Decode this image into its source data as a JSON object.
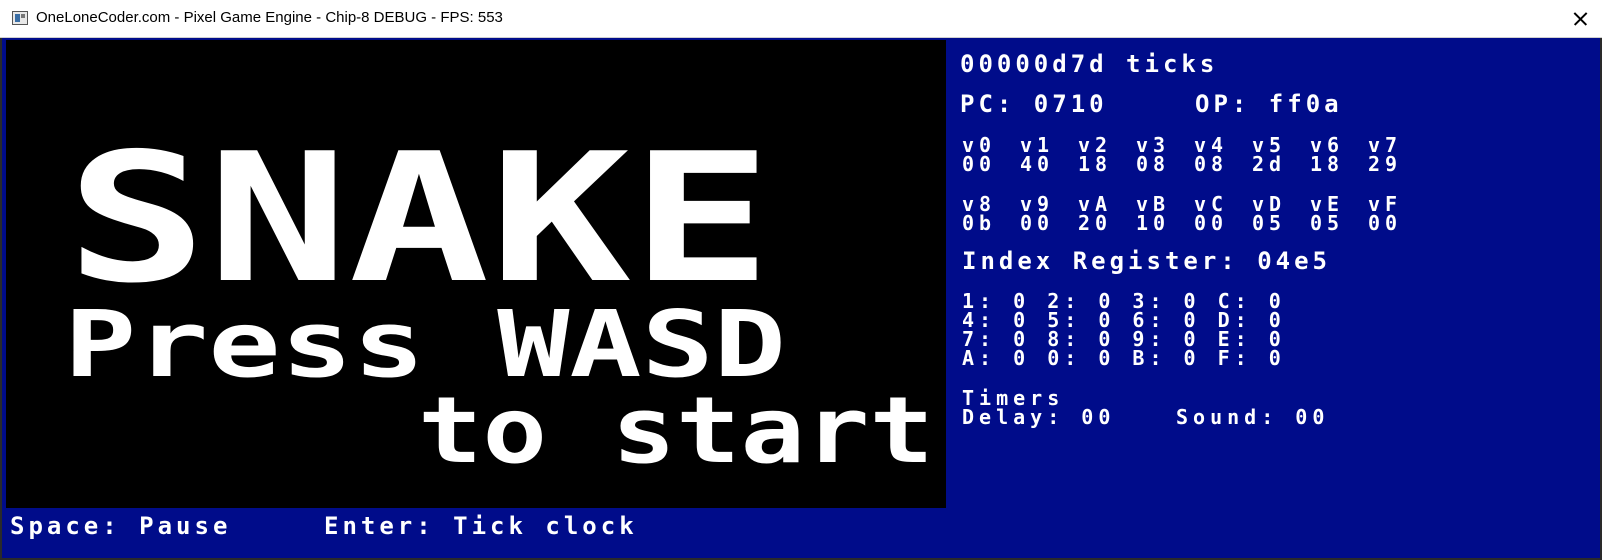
{
  "window": {
    "title": "OneLoneCoder.com - Pixel Game Engine - Chip-8 DEBUG - FPS: 553",
    "app_icon": "app-window-icon",
    "close_icon": "close-icon"
  },
  "screen": {
    "title_text": "SNAKE",
    "line1": "Press WASD",
    "line2": "to start"
  },
  "debug": {
    "ticks": "00000d7d ticks",
    "pc": "PC: 0710",
    "op": "OP: ff0a",
    "registers_row1": [
      {
        "name": "v0",
        "value": "00"
      },
      {
        "name": "v1",
        "value": "40"
      },
      {
        "name": "v2",
        "value": "18"
      },
      {
        "name": "v3",
        "value": "08"
      },
      {
        "name": "v4",
        "value": "08"
      },
      {
        "name": "v5",
        "value": "2d"
      },
      {
        "name": "v6",
        "value": "18"
      },
      {
        "name": "v7",
        "value": "29"
      }
    ],
    "registers_row2": [
      {
        "name": "v8",
        "value": "0b"
      },
      {
        "name": "v9",
        "value": "00"
      },
      {
        "name": "vA",
        "value": "20"
      },
      {
        "name": "vB",
        "value": "10"
      },
      {
        "name": "vC",
        "value": "00"
      },
      {
        "name": "vD",
        "value": "05"
      },
      {
        "name": "vE",
        "value": "05"
      },
      {
        "name": "vF",
        "value": "00"
      }
    ],
    "index_register": "Index Register: 04e5",
    "keys": [
      "1: 0 2: 0 3: 0 C: 0",
      "4: 0 5: 0 6: 0 D: 0",
      "7: 0 8: 0 9: 0 E: 0",
      "A: 0 0: 0 B: 0 F: 0"
    ],
    "timers_label": "Timers",
    "delay": "Delay: 00",
    "sound": "Sound: 00"
  },
  "footer": {
    "space_hint": "Space: Pause",
    "enter_hint": "Enter: Tick clock"
  },
  "colors": {
    "debug_background": "#000c8a",
    "screen_background": "#000000",
    "foreground": "#ffffff"
  }
}
